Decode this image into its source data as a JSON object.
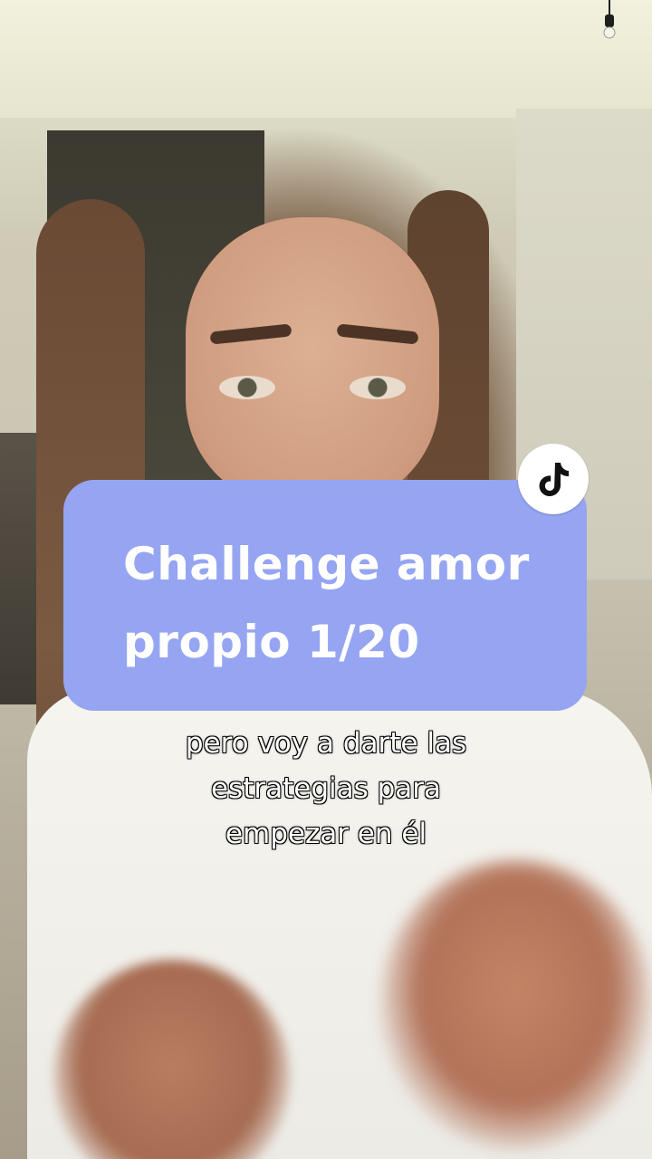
{
  "overlay_card": {
    "title_lines": [
      "Challenge amor",
      "propio 1/20"
    ],
    "background_color": "#96a5f2"
  },
  "badge": {
    "icon": "tiktok-logo-icon"
  },
  "caption": {
    "lines": [
      "pero voy a darte las",
      "estrategias para",
      "empezar en él"
    ]
  }
}
